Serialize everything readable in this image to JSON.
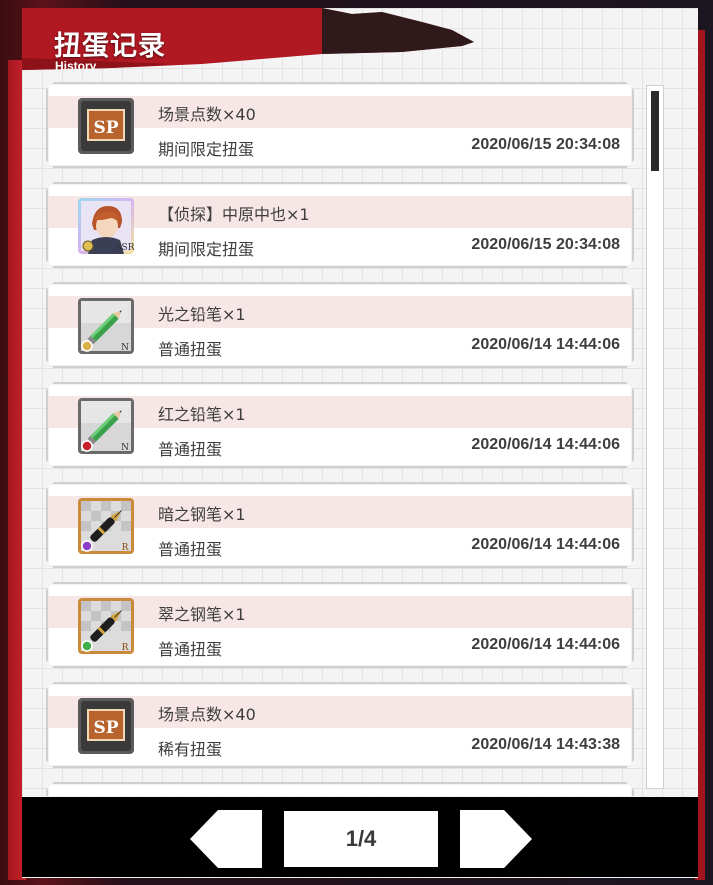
{
  "header": {
    "title": "扭蛋记录",
    "subtitle": "History"
  },
  "history": [
    {
      "item": "场景点数×40",
      "gacha": "期间限定扭蛋",
      "time": "2020/06/15 20:34:08",
      "icon": "sp-ticket-icon"
    },
    {
      "item": "【侦探】中原中也×1",
      "gacha": "期间限定扭蛋",
      "time": "2020/06/15 20:34:08",
      "icon": "character-card-icon",
      "rarity": "SSR"
    },
    {
      "item": "光之铅笔×1",
      "gacha": "普通扭蛋",
      "time": "2020/06/14 14:44:06",
      "icon": "pencil-icon",
      "rarity": "N",
      "element_color": "#d9b24a"
    },
    {
      "item": "红之铅笔×1",
      "gacha": "普通扭蛋",
      "time": "2020/06/14 14:44:06",
      "icon": "pencil-icon",
      "rarity": "N",
      "element_color": "#c8202a"
    },
    {
      "item": "暗之钢笔×1",
      "gacha": "普通扭蛋",
      "time": "2020/06/14 14:44:06",
      "icon": "fountain-pen-icon",
      "rarity": "R",
      "element_color": "#8a3fc9"
    },
    {
      "item": "翠之钢笔×1",
      "gacha": "普通扭蛋",
      "time": "2020/06/14 14:44:06",
      "icon": "fountain-pen-icon",
      "rarity": "R",
      "element_color": "#3fae4a"
    },
    {
      "item": "场景点数×40",
      "gacha": "稀有扭蛋",
      "time": "2020/06/14 14:43:38",
      "icon": "sp-ticket-icon"
    }
  ],
  "sp_label": "SP",
  "pagination": {
    "label": "1/4",
    "current": 1,
    "total": 4
  },
  "colors": {
    "accent_red": "#b01822",
    "row_band": "#f6e7e6"
  }
}
